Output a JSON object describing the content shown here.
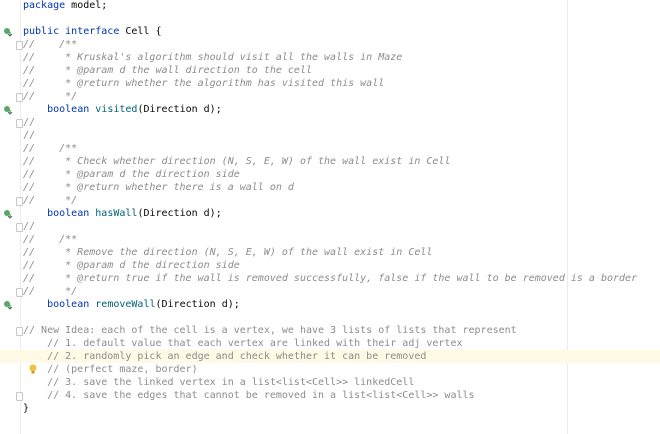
{
  "editor": {
    "language": "java",
    "accent": "#0033b3",
    "comment_color": "#8c8c8c",
    "highlight_line": 27,
    "lines": [
      {
        "text": "package model;",
        "kind": "plain"
      },
      {
        "text": "",
        "kind": "plain"
      },
      {
        "text": "public interface Cell {",
        "kind": "decl",
        "icon": "implemented-icon"
      },
      {
        "text": "//    /**",
        "kind": "comment",
        "fold": true
      },
      {
        "text": "//     * Kruskal's algorithm should visit all the walls in Maze",
        "kind": "comment"
      },
      {
        "text": "//     * @param d the wall direction to the cell",
        "kind": "comment"
      },
      {
        "text": "//     * @return whether the algorithm has visited this wall",
        "kind": "comment"
      },
      {
        "text": "//     */",
        "kind": "comment",
        "fold": true
      },
      {
        "text": "    boolean visited(Direction d);",
        "kind": "method",
        "method": "visited",
        "icon": "implemented-icon"
      },
      {
        "text": "//",
        "kind": "comment",
        "fold": true
      },
      {
        "text": "//",
        "kind": "comment"
      },
      {
        "text": "//    /**",
        "kind": "comment"
      },
      {
        "text": "//     * Check whether direction (N, S, E, W) of the wall exist in Cell",
        "kind": "comment"
      },
      {
        "text": "//     * @param d the direction side",
        "kind": "comment"
      },
      {
        "text": "//     * @return whether there is a wall on d",
        "kind": "comment"
      },
      {
        "text": "//     */",
        "kind": "comment",
        "fold": true
      },
      {
        "text": "    boolean hasWall(Direction d);",
        "kind": "method",
        "method": "hasWall",
        "icon": "implemented-icon"
      },
      {
        "text": "//",
        "kind": "comment",
        "fold": true
      },
      {
        "text": "//    /**",
        "kind": "comment"
      },
      {
        "text": "//     * Remove the direction (N, S, E, W) of the wall exist in Cell",
        "kind": "comment"
      },
      {
        "text": "//     * @param d the direction side",
        "kind": "comment"
      },
      {
        "text": "//     * @return true if the wall is removed successfully, false if the wall to be removed is a border",
        "kind": "comment"
      },
      {
        "text": "//     */",
        "kind": "comment",
        "fold": true
      },
      {
        "text": "    boolean removeWall(Direction d);",
        "kind": "method",
        "method": "removeWall",
        "icon": "implemented-icon"
      },
      {
        "text": "",
        "kind": "plain"
      },
      {
        "text": "// New Idea: each of the cell is a vertex, we have 3 lists of lists that represent",
        "kind": "comment",
        "fold": true
      },
      {
        "text": "    // 1. default value that each vertex are linked with their adj vertex",
        "kind": "comment"
      },
      {
        "text": "    // 2. randomly pick an edge and check whether it can be removed",
        "kind": "comment"
      },
      {
        "text": "    // (perfect maze, border)",
        "kind": "comment",
        "bulb": true
      },
      {
        "text": "    // 3. save the linked vertex in a list<list<Cell>> linkedCell",
        "kind": "comment"
      },
      {
        "text": "    // 4. save the edges that cannot be removed in a list<list<Cell>> walls",
        "kind": "comment",
        "fold": true
      },
      {
        "text": "}",
        "kind": "plain"
      }
    ]
  }
}
